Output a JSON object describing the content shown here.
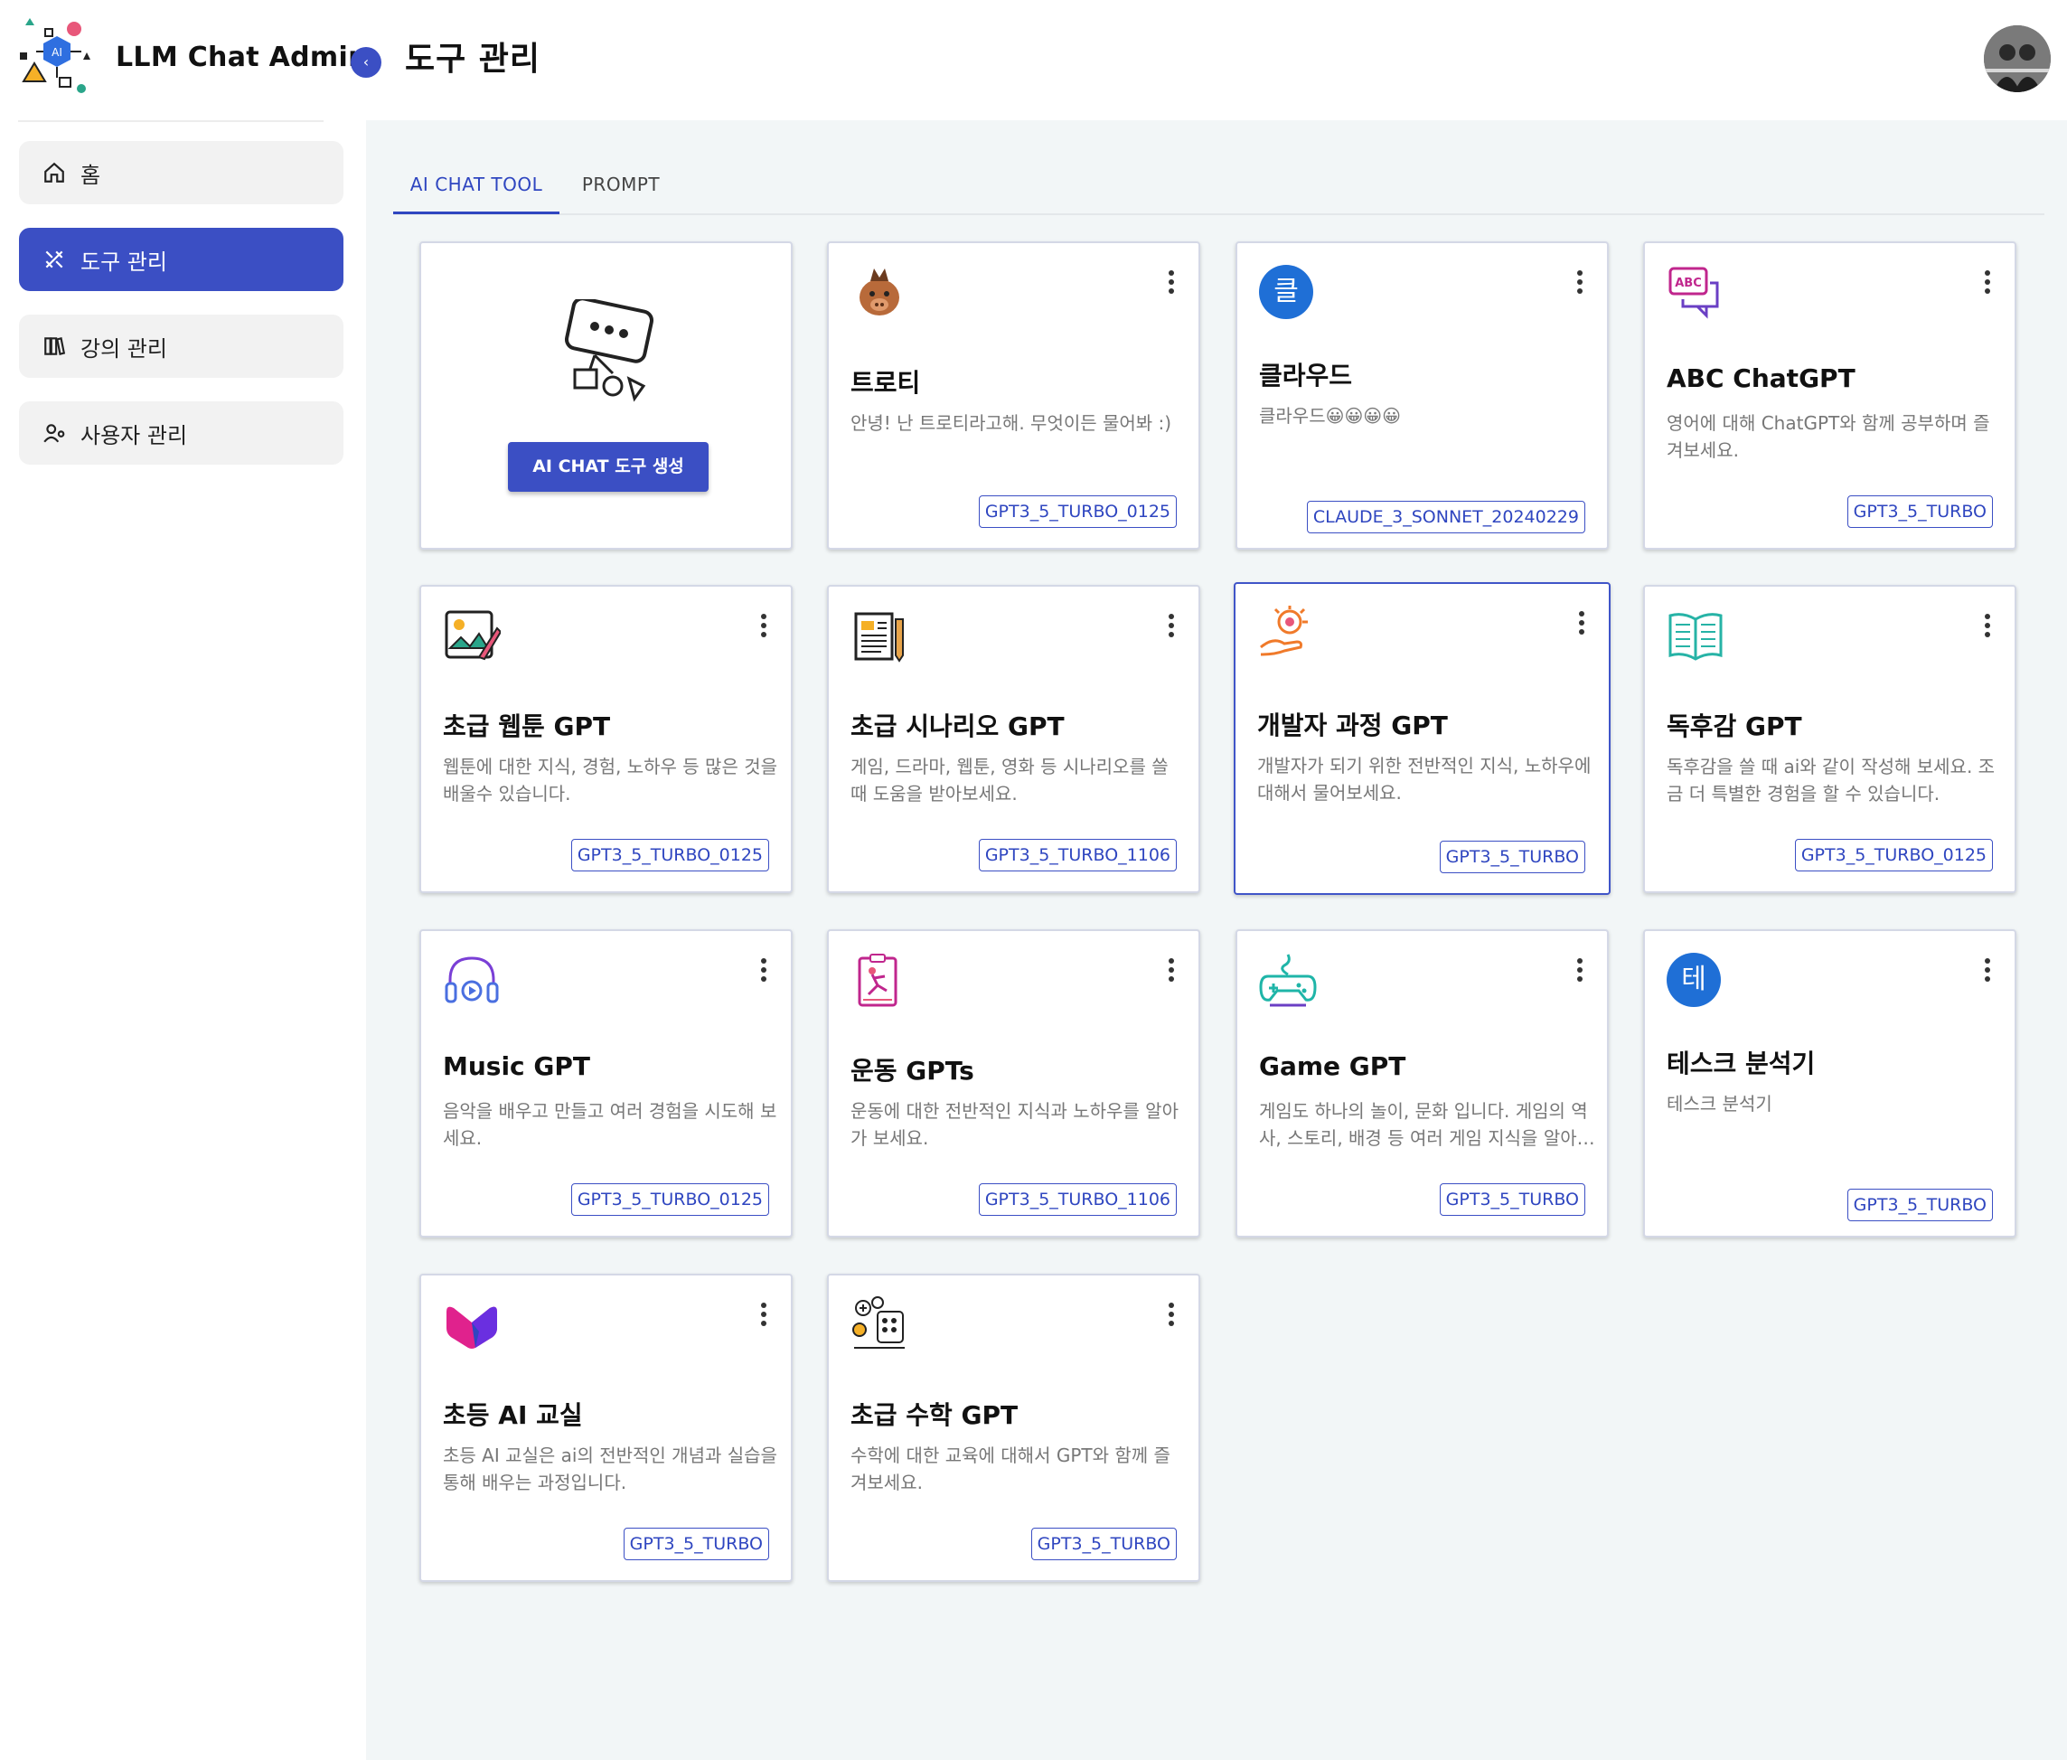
{
  "app": {
    "title": "LLM Chat Admin"
  },
  "header": {
    "page_title": "도구 관리",
    "collapse_icon": "‹"
  },
  "sidebar": {
    "items": [
      {
        "label": "홈",
        "icon": "home-icon",
        "active": false
      },
      {
        "label": "도구 관리",
        "icon": "tools-icon",
        "active": true
      },
      {
        "label": "강의 관리",
        "icon": "books-icon",
        "active": false
      },
      {
        "label": "사용자 관리",
        "icon": "user-settings-icon",
        "active": false
      }
    ]
  },
  "tabs": [
    {
      "label": "AI CHAT TOOL",
      "active": true
    },
    {
      "label": "PROMPT",
      "active": false
    }
  ],
  "create_card": {
    "button_label": "AI CHAT 도구 생성",
    "icon": "chat-robot-icon"
  },
  "tools": [
    {
      "title": "트로티",
      "desc": "안녕! 난 트로티라고해. 무엇이든 물어봐 :)",
      "model": "GPT3_5_TURBO_0125",
      "icon": "boar-icon"
    },
    {
      "title": "클라우드",
      "desc": "클라우드😀😀😀😀",
      "model": "CLAUDE_3_SONNET_20240229",
      "icon": "letter-avatar",
      "letter": "클"
    },
    {
      "title": "ABC ChatGPT",
      "desc": "영어에 대해 ChatGPT와 함께 공부하며 즐겨보세요.",
      "model": "GPT3_5_TURBO",
      "icon": "abc-chat-icon"
    },
    {
      "title": "초급 웹툰 GPT",
      "desc": "웹툰에 대한 지식, 경험, 노하우 등 많은 것을 배울수 있습니다.",
      "model": "GPT3_5_TURBO_0125",
      "icon": "drawing-icon"
    },
    {
      "title": "초급 시나리오 GPT",
      "desc": "게임, 드라마, 웹툰, 영화 등 시나리오를 쓸 때 도움을 받아보세요.",
      "model": "GPT3_5_TURBO_1106",
      "icon": "script-icon"
    },
    {
      "title": "개발자 과정 GPT",
      "desc": "개발자가 되기 위한 전반적인 지식, 노하우에 대해서 물어보세요.",
      "model": "GPT3_5_TURBO",
      "icon": "idea-hand-icon"
    },
    {
      "title": "독후감 GPT",
      "desc": "독후감을 쓸 때 ai와 같이 작성해 보세요. 조금 더 특별한 경험을 할 수 있습니다.",
      "model": "GPT3_5_TURBO_0125",
      "icon": "open-book-icon"
    },
    {
      "title": "Music GPT",
      "desc": "음악을 배우고 만들고 여러 경험을 시도해 보세요.",
      "model": "GPT3_5_TURBO_0125",
      "icon": "headphones-icon"
    },
    {
      "title": "운동 GPTs",
      "desc": "운동에 대한 전반적인 지식과 노하우를 알아가 보세요.",
      "model": "GPT3_5_TURBO_1106",
      "icon": "exercise-icon"
    },
    {
      "title": "Game GPT",
      "desc": "게임도 하나의 놀이, 문화 입니다. 게임의 역사, 스토리, 배경 등 여러 게임 지식을 알아보세요.",
      "model": "GPT3_5_TURBO",
      "icon": "gamepad-icon"
    },
    {
      "title": "테스크 분석기",
      "desc": "테스크 분석기",
      "model": "GPT3_5_TURBO",
      "icon": "letter-avatar",
      "letter": "테"
    },
    {
      "title": "초등 AI 교실",
      "desc": "초등 AI 교실은 ai의 전반적인 개념과 실습을 통해 배우는 과정입니다.",
      "model": "GPT3_5_TURBO",
      "icon": "m-logo-icon"
    },
    {
      "title": "초급 수학 GPT",
      "desc": "수학에 대한 교육에 대해서 GPT와 함께 즐겨보세요.",
      "model": "GPT3_5_TURBO",
      "icon": "math-icon"
    }
  ],
  "colors": {
    "primary": "#3b4fc4",
    "background": "#f2f6f7",
    "letter_avatar": "#1f6fd6"
  }
}
